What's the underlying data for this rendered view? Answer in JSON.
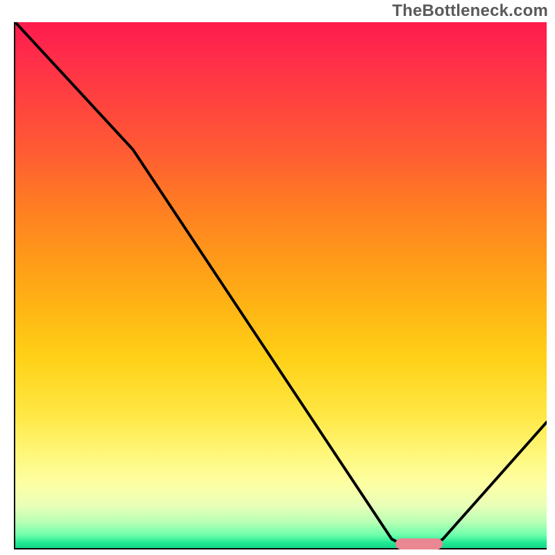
{
  "watermark": "TheBottleneck.com",
  "colors": {
    "gradient_top": "#ff1a4d",
    "gradient_mid": "#ffd117",
    "gradient_bottom": "#14d68b",
    "curve": "#000000",
    "marker": "#e98792",
    "axis": "#000000"
  },
  "chart_data": {
    "type": "line",
    "title": "",
    "xlabel": "",
    "ylabel": "",
    "xlim": [
      0,
      100
    ],
    "ylim": [
      0,
      100
    ],
    "x": [
      0,
      22,
      72,
      78,
      100
    ],
    "values": [
      100,
      76,
      1,
      1,
      24
    ],
    "optimum_range_x": [
      72,
      78
    ],
    "optimum_value": 1,
    "legend": false,
    "grid": false
  }
}
